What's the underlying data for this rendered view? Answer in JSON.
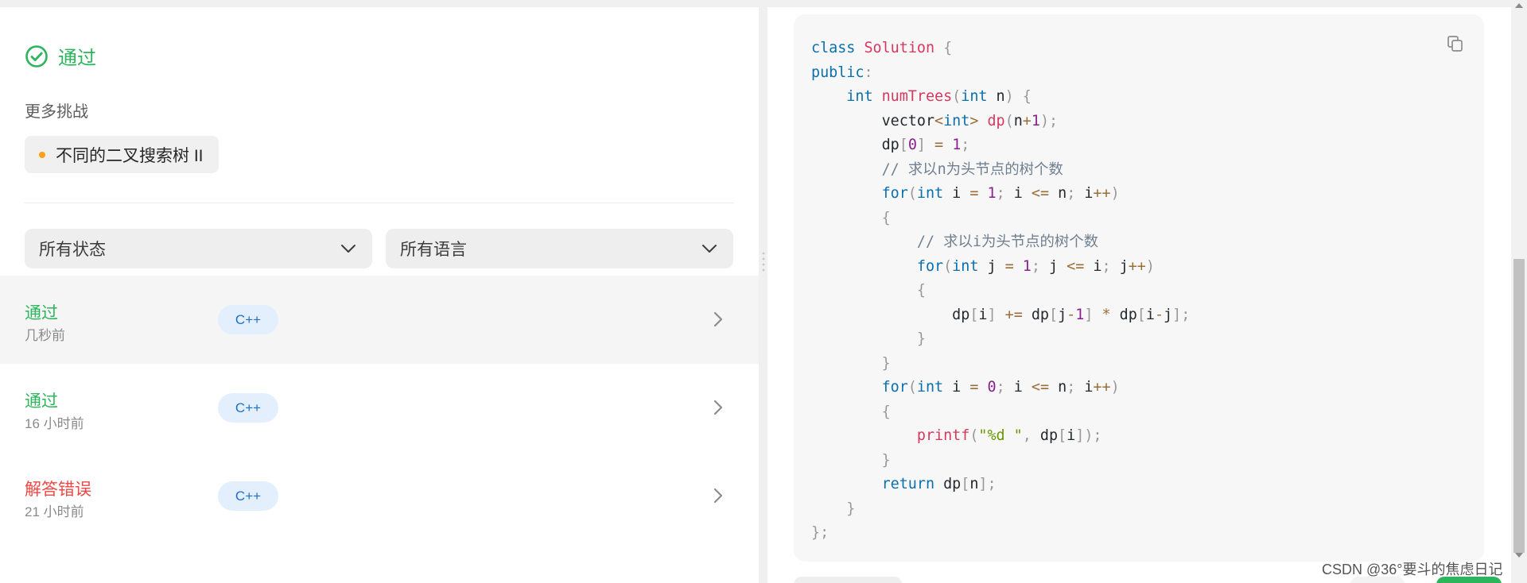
{
  "result": {
    "status": "通过"
  },
  "more": {
    "heading": "更多挑战",
    "challenges": [
      {
        "title": "不同的二叉搜索树 II"
      }
    ]
  },
  "filters": {
    "status": {
      "selected": "所有状态"
    },
    "language": {
      "selected": "所有语言"
    }
  },
  "submissions": [
    {
      "status": "通过",
      "time": "几秒前",
      "lang": "C++",
      "status_color": "#2db55d"
    },
    {
      "status": "通过",
      "time": "16 小时前",
      "lang": "C++",
      "status_color": "#2db55d"
    },
    {
      "status": "解答错误",
      "time": "21 小时前",
      "lang": "C++",
      "status_color": "#ef4743"
    }
  ],
  "code": {
    "language": "C++",
    "lines": [
      "class Solution {",
      "public:",
      "    int numTrees(int n) {",
      "        vector<int> dp(n+1);",
      "        dp[0] = 1;",
      "        // 求以n为头节点的树个数",
      "        for(int i = 1; i <= n; i++)",
      "        {",
      "            // 求以i为头节点的树个数",
      "            for(int j = 1; j <= i; j++)",
      "            {",
      "                dp[i] += dp[j-1] * dp[i-j];",
      "            }",
      "        }",
      "        for(int i = 0; i <= n; i++)",
      "        {",
      "            printf(\"%d \", dp[i]);",
      "        }",
      "        return dp[n];",
      "    }",
      "};"
    ]
  },
  "watermark": "CSDN @36°要斗的焦虑日记",
  "colors": {
    "accepted": "#2db55d",
    "wrong": "#ef4743",
    "brand": "#ffa116",
    "badge_text": "#1e6fc8"
  }
}
